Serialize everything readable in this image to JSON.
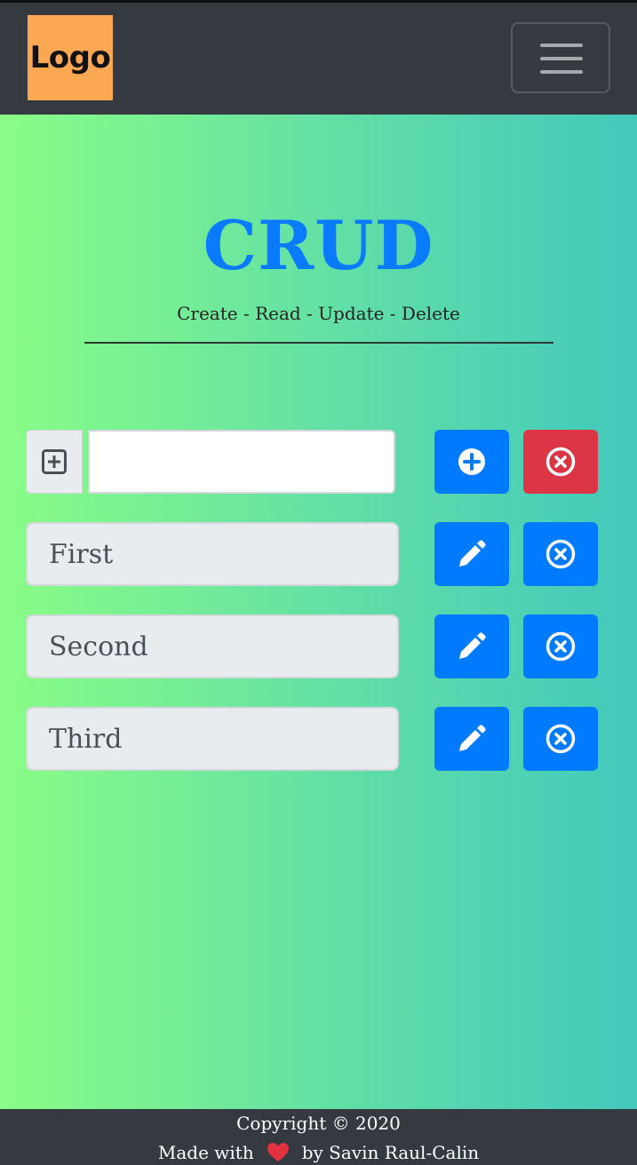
{
  "navbar": {
    "logo_text": "Logo",
    "logo_color": "#fca853",
    "toggler_icon": "hamburger-icon"
  },
  "header": {
    "title": "CRUD",
    "subtitle": "Create - Read - Update - Delete"
  },
  "new_item": {
    "prepend_icon": "plus-square-icon",
    "input_value": "",
    "add_button_icon": "plus-circle-icon",
    "clear_button_icon": "x-circle-icon"
  },
  "items": [
    {
      "label": "First",
      "edit_icon": "pencil-icon",
      "delete_icon": "x-circle-icon"
    },
    {
      "label": "Second",
      "edit_icon": "pencil-icon",
      "delete_icon": "x-circle-icon"
    },
    {
      "label": "Third",
      "edit_icon": "pencil-icon",
      "delete_icon": "x-circle-icon"
    }
  ],
  "footer": {
    "copyright": "Copyright © 2020",
    "made_with": "Made with",
    "heart_icon": "heart-icon",
    "author": "by Savin Raul-Calin"
  },
  "colors": {
    "primary": "#007bff",
    "danger": "#dc3545",
    "title": "#0a7bff",
    "dark": "#343a40",
    "gradient_start": "#8afd86",
    "gradient_end": "#43c8bc"
  }
}
